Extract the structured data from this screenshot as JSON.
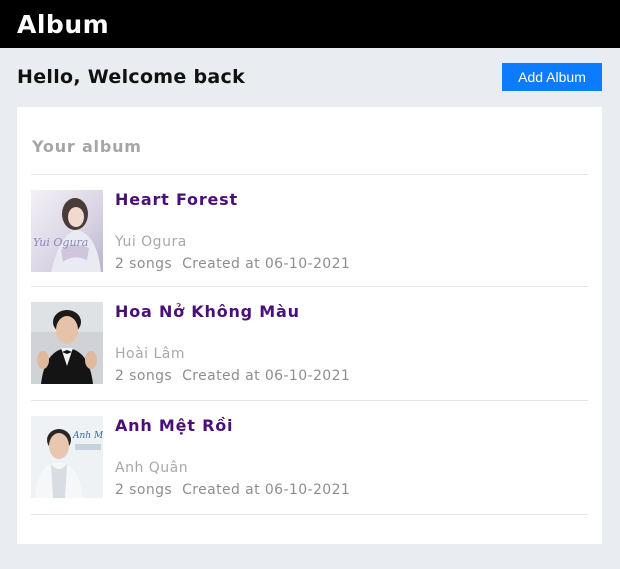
{
  "header": {
    "title": "Album"
  },
  "subheader": {
    "greeting": "Hello, Welcome back",
    "add_button": "Add Album"
  },
  "album_list": {
    "title": "Your album",
    "items": [
      {
        "name": "Heart Forest",
        "artist": "Yui Ogura",
        "songs": "2 songs",
        "created": "Created at 06-10-2021",
        "thumb_text": "Yui Ogura"
      },
      {
        "name": "Hoa Nở Không Màu",
        "artist": "Hoài Lâm",
        "songs": "2 songs",
        "created": "Created at 06-10-2021"
      },
      {
        "name": "Anh Mệt Rồi",
        "artist": "Anh Quân",
        "songs": "2 songs",
        "created": "Created at 06-10-2021",
        "thumb_text": "Anh Mệt Rồi"
      }
    ]
  }
}
